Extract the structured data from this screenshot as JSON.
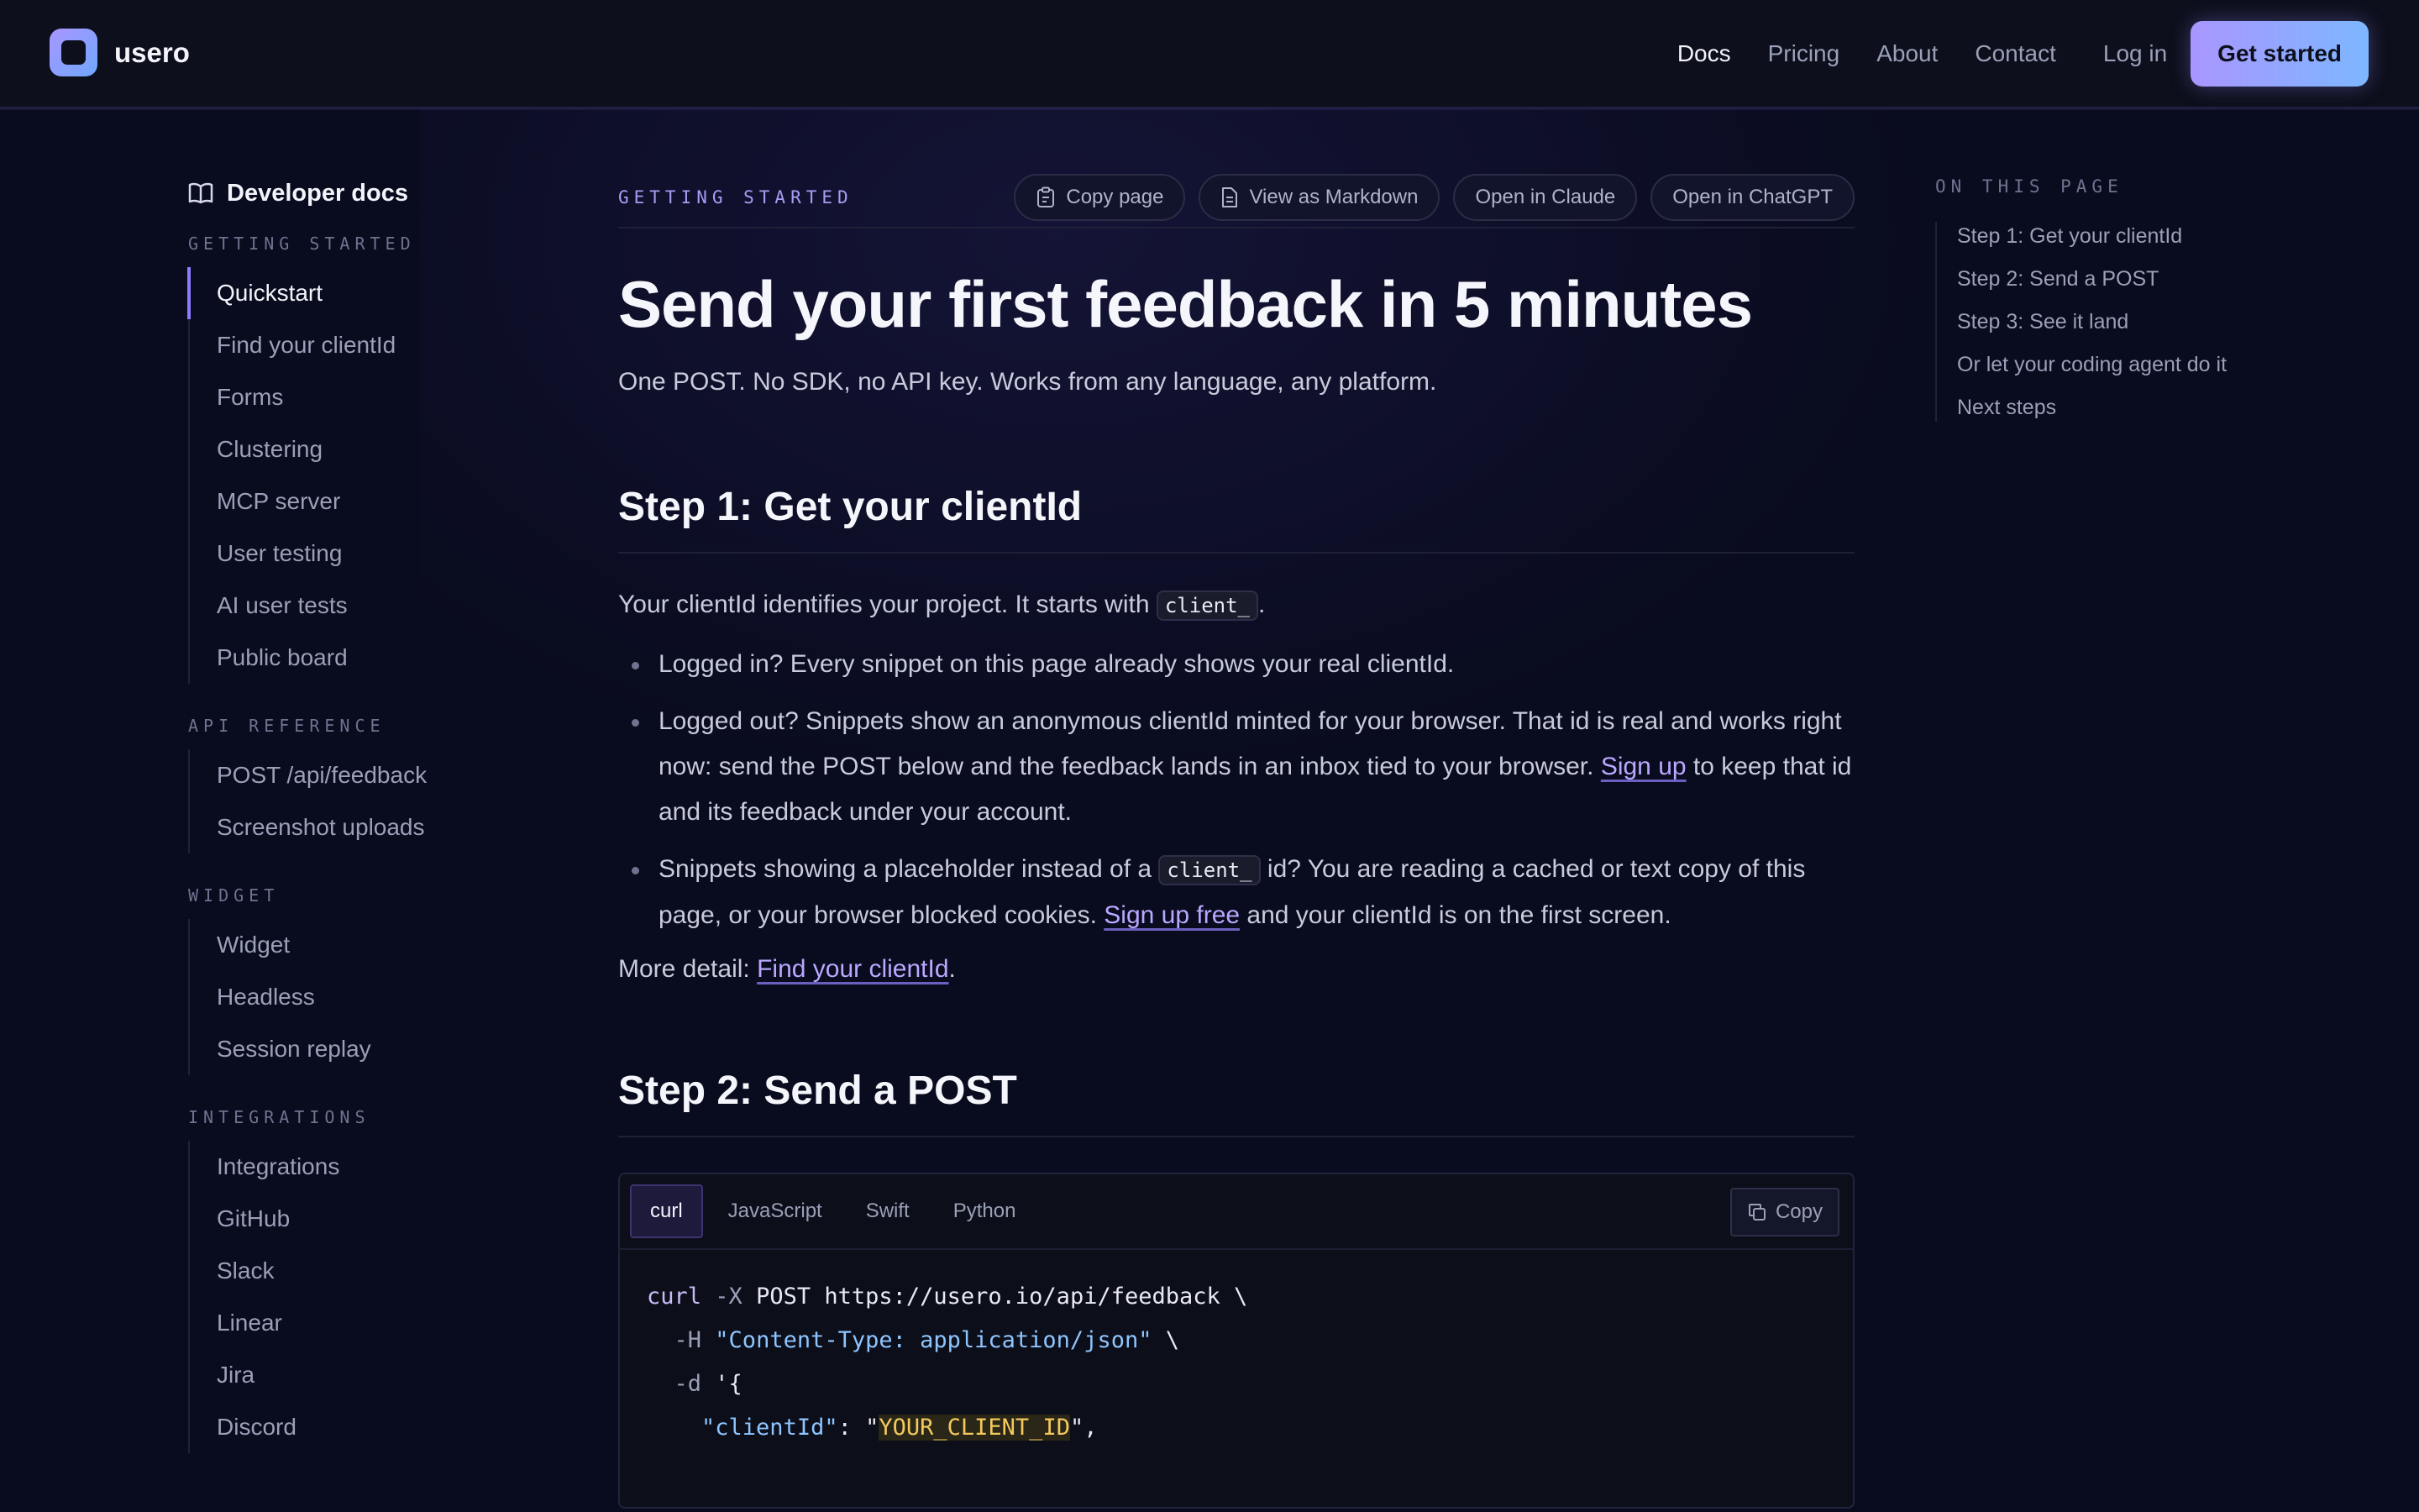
{
  "brand": {
    "name": "usero"
  },
  "nav": {
    "links": [
      "Docs",
      "Pricing",
      "About",
      "Contact"
    ],
    "login": "Log in",
    "cta": "Get started"
  },
  "sidebar": {
    "title": "Developer docs",
    "sections": [
      {
        "label": "GETTING STARTED",
        "items": [
          "Quickstart",
          "Find your clientId",
          "Forms",
          "Clustering",
          "MCP server",
          "User testing",
          "AI user tests",
          "Public board"
        ]
      },
      {
        "label": "API REFERENCE",
        "items": [
          "POST /api/feedback",
          "Screenshot uploads"
        ]
      },
      {
        "label": "WIDGET",
        "items": [
          "Widget",
          "Headless",
          "Session replay"
        ]
      },
      {
        "label": "INTEGRATIONS",
        "items": [
          "Integrations",
          "GitHub",
          "Slack",
          "Linear",
          "Jira",
          "Discord"
        ]
      }
    ]
  },
  "main": {
    "crumb": "GETTING STARTED",
    "actions": [
      "Copy page",
      "View as Markdown",
      "Open in Claude",
      "Open in ChatGPT"
    ],
    "title": "Send your first feedback in 5 minutes",
    "lead": "One POST. No SDK, no API key. Works from any language, any platform.",
    "step1": {
      "heading": "Step 1: Get your clientId",
      "intro_pre": "Your clientId identifies your project. It starts with ",
      "intro_code": "client_",
      "intro_post": ".",
      "bullet1": "Logged in? Every snippet on this page already shows your real clientId.",
      "bullet2_pre": "Logged out? Snippets show an anonymous clientId minted for your browser. That id is real and works right now: send the POST below and the feedback lands in an inbox tied to your browser. ",
      "bullet2_link": "Sign up",
      "bullet2_post": " to keep that id and its feedback under your account.",
      "bullet3_pre": "Snippets showing a placeholder instead of a ",
      "bullet3_code": "client_",
      "bullet3_mid": " id? You are reading a cached or text copy of this page, or your browser blocked cookies. ",
      "bullet3_link": "Sign up free",
      "bullet3_post": " and your clientId is on the first screen.",
      "detail_pre": "More detail: ",
      "detail_link": "Find your clientId",
      "detail_post": "."
    },
    "step2": {
      "heading": "Step 2: Send a POST",
      "tabs": [
        "curl",
        "JavaScript",
        "Swift",
        "Python"
      ],
      "copy": "Copy",
      "code": {
        "l1_cmd": "curl",
        "l1_flag": "-X",
        "l1_rest": " POST https://usero.io/api/feedback \\",
        "l2_flag": "-H",
        "l2_str": "\"Content-Type: application/json\"",
        "l2_rest": " \\",
        "l3_flag": "-d",
        "l3_rest": " '{",
        "l4_key": "\"clientId\"",
        "l4_sep": ": \"",
        "l4_ph": "YOUR_CLIENT_ID",
        "l4_end": "\","
      }
    }
  },
  "toc": {
    "title": "ON THIS PAGE",
    "items": [
      "Step 1: Get your clientId",
      "Step 2: Send a POST",
      "Step 3: See it land",
      "Or let your coding agent do it",
      "Next steps"
    ]
  }
}
